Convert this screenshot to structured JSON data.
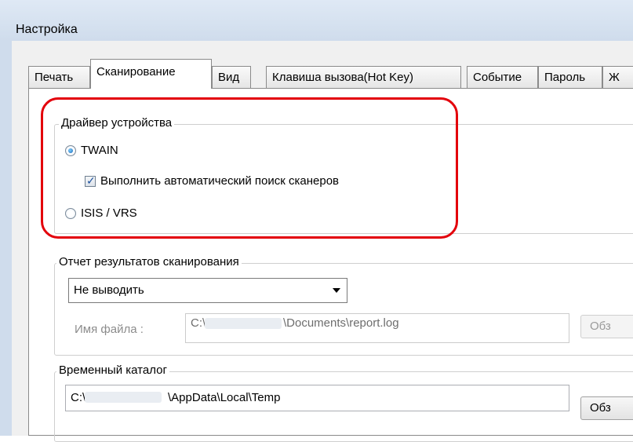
{
  "window": {
    "title": "Настройка"
  },
  "tabs": [
    {
      "label": "Печать"
    },
    {
      "label": "Сканирование",
      "active": true
    },
    {
      "label": "Вид"
    },
    {
      "label": "Клавиша вызова(Hot Key)"
    },
    {
      "label": "Событие"
    },
    {
      "label": "Пароль"
    },
    {
      "label": "Ж"
    }
  ],
  "device_driver": {
    "group_label": "Драйвер устройства",
    "twain_label": "TWAIN",
    "twain_selected": true,
    "auto_search_label": "Выполнить автоматический поиск сканеров",
    "auto_search_checked": true,
    "isis_label": "ISIS / VRS",
    "isis_selected": false
  },
  "scan_report": {
    "group_label": "Отчет результатов сканирования",
    "output_value": "Не выводить",
    "file_name_label": "Имя файла :",
    "file_path_prefix": "C:\\",
    "file_path_suffix": "\\Documents\\report.log",
    "browse_label": "Обз"
  },
  "temp_folder": {
    "group_label": "Временный каталог",
    "path_prefix": "C:\\",
    "path_suffix": "\\AppData\\Local\\Temp",
    "browse_label": "Обз"
  },
  "colors": {
    "highlight": "#e3000b",
    "titlebar": "#dfe9f5",
    "radio_selected": "#1462b5"
  }
}
